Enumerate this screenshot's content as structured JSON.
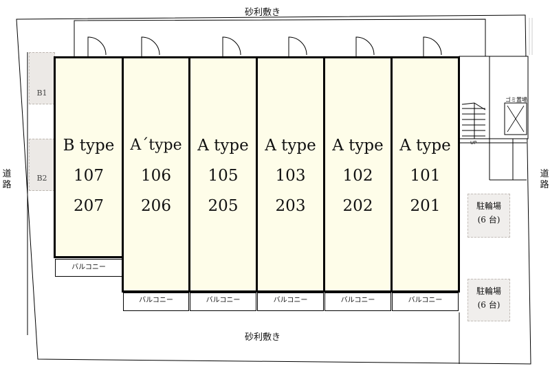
{
  "top_label": "砂利敷き",
  "bottom_label": "砂利敷き",
  "road_left": "道路",
  "road_right": "道路",
  "parking": [
    {
      "label": "B1"
    },
    {
      "label": "B2"
    }
  ],
  "units": [
    {
      "type": "B type",
      "room1": "107",
      "room2": "207"
    },
    {
      "type": "A´type",
      "room1": "106",
      "room2": "206"
    },
    {
      "type": "A type",
      "room1": "105",
      "room2": "205"
    },
    {
      "type": "A type",
      "room1": "103",
      "room2": "203"
    },
    {
      "type": "A type",
      "room1": "102",
      "room2": "202"
    },
    {
      "type": "A type",
      "room1": "101",
      "room2": "201"
    }
  ],
  "balconies": [
    "バルコニー",
    "バルコニー",
    "バルコニー",
    "バルコニー",
    "バルコニー",
    "バルコニー"
  ],
  "stairs_label": "UP",
  "garbage_label": "ゴミ置場",
  "bike_parking": [
    {
      "name": "駐輪場",
      "capacity": "(6 台)"
    },
    {
      "name": "駐輪場",
      "capacity": "(6 台)"
    }
  ],
  "colors": {
    "unit_fill": "#fefde9",
    "parking_fill": "#ece9e6",
    "walls": "#000000"
  }
}
